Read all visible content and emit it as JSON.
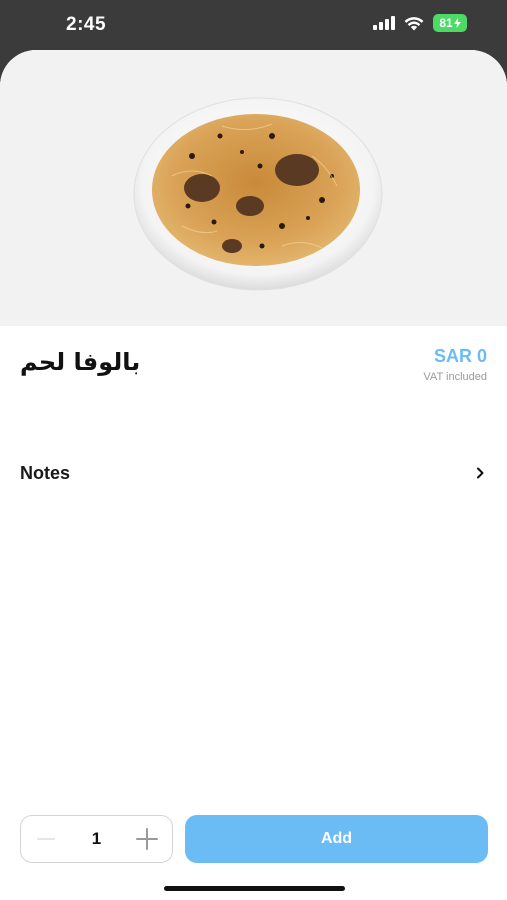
{
  "status_bar": {
    "time": "2:45",
    "battery": "81"
  },
  "item": {
    "name": "بالوفا لحم",
    "price": "SAR 0",
    "vat_note": "VAT included",
    "image_icon": "dish-photo"
  },
  "notes": {
    "label": "Notes",
    "chevron": "chevron-right-icon"
  },
  "footer": {
    "quantity": "1",
    "add_label": "Add"
  },
  "colors": {
    "accent": "#6bbcf5",
    "status_bar_bg": "#3b3b3b",
    "battery": "#4cd964"
  }
}
